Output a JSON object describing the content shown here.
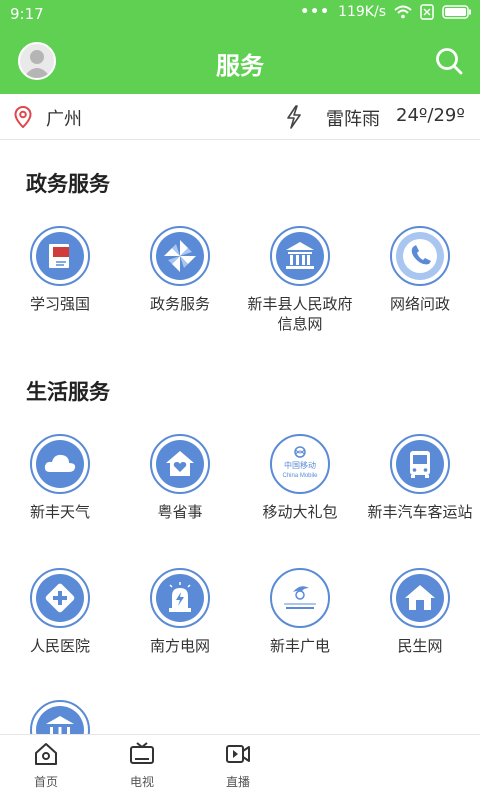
{
  "status_bar": {
    "time": "9:17",
    "speed": "119K/s"
  },
  "header": {
    "title": "服务"
  },
  "weather": {
    "city": "广州",
    "description": "雷阵雨",
    "temperature": "24º/29º"
  },
  "sections": {
    "gov": {
      "title": "政务服务",
      "items": [
        {
          "label": "学习强国",
          "icon": "flag-book-icon"
        },
        {
          "label": "政务服务",
          "icon": "pinwheel-icon"
        },
        {
          "label": "新丰县人民政府信息网",
          "icon": "government-building-icon"
        },
        {
          "label": "网络问政",
          "icon": "phone-icon"
        }
      ]
    },
    "life": {
      "title": "生活服务",
      "items": [
        {
          "label": "新丰天气",
          "icon": "cloud-icon"
        },
        {
          "label": "粤省事",
          "icon": "house-heart-icon"
        },
        {
          "label": "移动大礼包",
          "icon": "china-mobile-logo",
          "logo_cn": "中国移动",
          "logo_en": "China Mobile"
        },
        {
          "label": "新丰汽车客运站",
          "icon": "bus-icon"
        },
        {
          "label": "人民医院",
          "icon": "medical-cross-icon"
        },
        {
          "label": "南方电网",
          "icon": "power-alarm-icon"
        },
        {
          "label": "新丰广电",
          "icon": "broadcast-logo"
        },
        {
          "label": "民生网",
          "icon": "house-icon"
        },
        {
          "label": "",
          "icon": "building-icon"
        }
      ]
    }
  },
  "tabbar": {
    "tabs": [
      {
        "label": "首页",
        "icon": "home-icon"
      },
      {
        "label": "电视",
        "icon": "tv-icon"
      },
      {
        "label": "直播",
        "icon": "video-icon"
      }
    ]
  },
  "colors": {
    "brand_green": "#5fd052",
    "icon_blue": "#5b8bd6"
  }
}
